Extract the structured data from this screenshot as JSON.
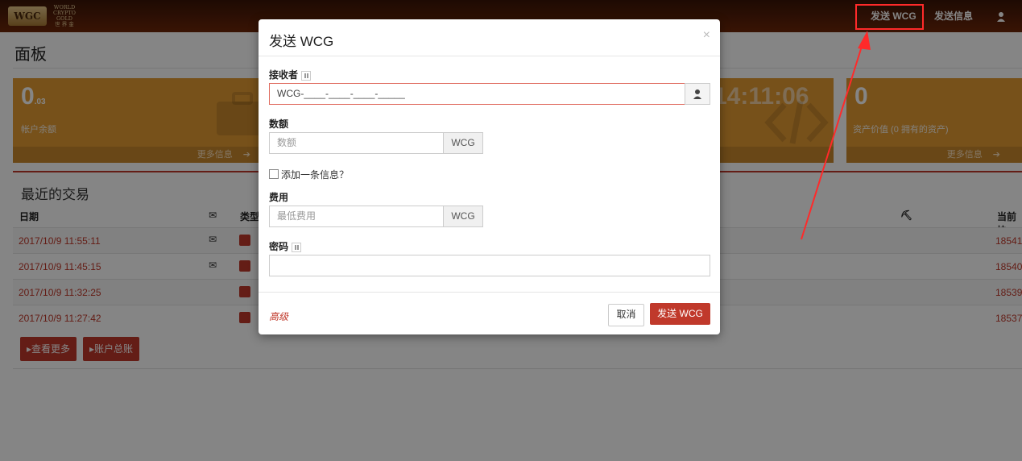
{
  "navbar": {
    "logo_badge": "WGC",
    "logo_text": [
      "WORLD",
      "CRYPTO",
      "GOLD",
      "世 界 金"
    ],
    "send_wcg": "发送 WCG",
    "send_message": "发送信息",
    "user_icon": "user-icon"
  },
  "page": {
    "title": "面板"
  },
  "cards": [
    {
      "value": "0",
      "suffix": ".03",
      "label": "帐户余额",
      "footer": "更多信息",
      "icon": "briefcase-icon",
      "color": "#e59c33"
    },
    {
      "value": "14:11:06",
      "icon": "code-icon",
      "color": "#e59c33"
    },
    {
      "value": "0",
      "label": "资产价值 (0 拥有的资产)",
      "footer": "更多信息",
      "color": "#e59c33"
    }
  ],
  "transactions": {
    "title": "最近的交易",
    "headers": {
      "date": "日期",
      "type": "类型",
      "block": "当前块"
    },
    "rows": [
      {
        "date": "2017/10/9 11:55:11",
        "message": true,
        "block": "18541"
      },
      {
        "date": "2017/10/9 11:45:15",
        "message": true,
        "block": "18540"
      },
      {
        "date": "2017/10/9 11:32:25",
        "message": false,
        "block": "18539"
      },
      {
        "date": "2017/10/9 11:27:42",
        "message": false,
        "block": "18537"
      }
    ],
    "buttons": {
      "view_more": "查看更多",
      "ledger": "账户总账"
    }
  },
  "modal": {
    "title": "发送 WCG",
    "close": "×",
    "recipient_label": "接收者",
    "recipient_value": "WCG-____-____-____-_____",
    "amount_label": "数额",
    "amount_placeholder": "数额",
    "amount_unit": "WCG",
    "add_message": "添加一条信息？",
    "fee_label": "费用",
    "fee_placeholder": "最低费用",
    "fee_unit": "WCG",
    "password_label": "密码",
    "advanced": "高级",
    "cancel": "取消",
    "submit": "发送 WCG"
  },
  "colors": {
    "accent": "#c0392b",
    "card": "#e59c33",
    "annotation": "#ff2a2a"
  }
}
